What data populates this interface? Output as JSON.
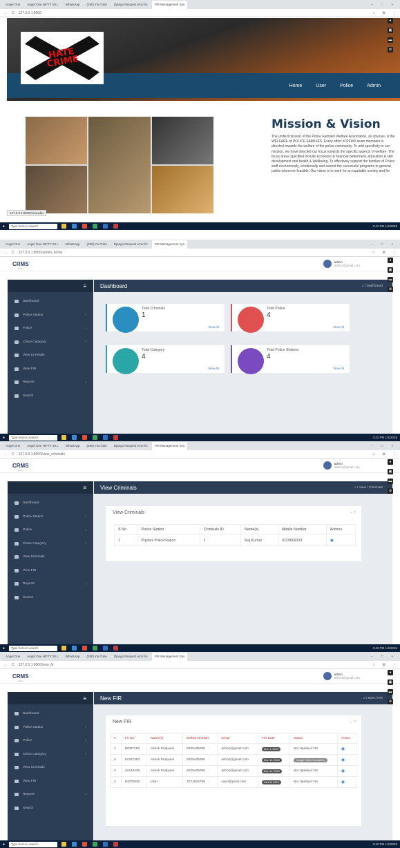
{
  "browser": {
    "tabs": [
      "Angel One",
      "Angel One NIFTY 50 L",
      "WhatsApp",
      "(280) YouTube",
      "Django Request error fix",
      "FIR Management Sys"
    ],
    "tabs_admin": [
      "Angel One",
      "Angel One NIFTY 50 L",
      "WhatsApp",
      "(280) YouTube",
      "Django Request error fix",
      "FIR Management Sys"
    ],
    "url_home": "127.0.0.1:8000",
    "url_dashboard": "127.0.0.1:8000/admin_home",
    "url_view_criminals": "127.0.0.1:8000/view_criminals",
    "url_newfir": "127.0.0.1:8000/new_fir"
  },
  "taskbar": {
    "search_placeholder": "Type here to search",
    "time1": "3:41 PM",
    "date1": "1/4/2025",
    "time2": "3:41 PM",
    "date2": "1/4/2025",
    "time3": "3:42 PM",
    "date3": "1/4/2025",
    "time4": "3:42 PM",
    "date4": "1/4/2025"
  },
  "home": {
    "logo_line1": "HATE",
    "logo_line2": "CRIME",
    "nav": [
      "Home",
      "User",
      "Police",
      "Admin"
    ],
    "mission_title": "Mission & Vision",
    "mission_text": "The unified mission of the Police Families Welfare Association, as obvious, is the WELFARE of POLICE FAMILIES. Every effort of PFWS team members is directed towards the welfare of the police community. To add specificity to our mission, we have directed our focus towards the specific aspects of welfare. The focus areas specified include economic & financial betterment, education & skill development and health & Wellbeing. To effectively support the families of Police staff economically, emotionally and extend the successful programs to general public wherever feasible. Our vision is to work for an equitable society and for",
    "status_url": "127.0.0.1:8000/view.php"
  },
  "admin": {
    "brand": "CRMS",
    "brand_sub": "admin",
    "user_name": "admin",
    "user_email": "admin@gmail.com",
    "menu_toggle": "≡",
    "menu": [
      "Dashboard",
      "Police Station",
      "Police",
      "Crime Category",
      "View Criminals",
      "View FIR",
      "Reports",
      "Search"
    ]
  },
  "dashboard": {
    "title": "Dashboard",
    "crumb": "/ Dashboard",
    "cards": [
      {
        "label": "Total Criminals",
        "value": "1",
        "link": "View All",
        "color": "#2a8fc0"
      },
      {
        "label": "Total Police",
        "value": "4",
        "link": "View All",
        "color": "#e05050"
      },
      {
        "label": "Total Category",
        "value": "4",
        "link": "View All",
        "color": "#2aa6a6"
      },
      {
        "label": "Total Police Stations",
        "value": "4",
        "link": "View All",
        "color": "#7a4ac0"
      }
    ]
  },
  "criminals": {
    "title": "View Criminals",
    "crumb": "/ View / Criminals",
    "panel_title": "View Criminals",
    "columns": [
      "S.No",
      "Police Station",
      "Criminals ID",
      "Name(s)",
      "Mobile Number",
      "Actions"
    ],
    "rows": [
      [
        "1",
        "Pipliani PoliceStation",
        "1",
        "Raj Kumar",
        "9229669333"
      ]
    ]
  },
  "newfir": {
    "title": "New FIR",
    "crumb": "/ New / FIR",
    "panel_title": "New FIR",
    "columns": [
      "#",
      "Fir No.",
      "Name(s)",
      "Mobile Number",
      "Email",
      "FIR Date",
      "Status",
      "Action"
    ],
    "rows": [
      [
        "1",
        "86087190",
        "Ashok Panjwani",
        "9229435095",
        "ashok@gmail.com",
        "Nov. 4, 2024",
        "Not Updated Yet"
      ],
      [
        "2",
        "52347393",
        "Ashok Panjwani",
        "9229435095",
        "ashok@gmail.com",
        "Nov. 11, 2024",
        "Charge Sheet Completed"
      ],
      [
        "3",
        "42443438",
        "Ashok Panjwani",
        "9229435095",
        "ashok@gmail.com",
        "Nov. 11, 2024",
        "Not Updated Yet"
      ],
      [
        "4",
        "84370830",
        "User",
        "7071976758",
        "user@gmail.com",
        "June 8, 2024",
        "Not Updated Yet"
      ]
    ]
  }
}
